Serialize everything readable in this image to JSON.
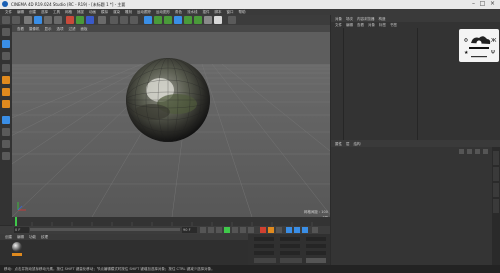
{
  "window": {
    "title": "CINEMA 4D R19.024 Studio (RC - R19) - [未标题 1 *] - 主要"
  },
  "menubar": {
    "items": [
      "文件",
      "编辑",
      "创建",
      "选择",
      "工具",
      "网格",
      "捕捉",
      "动画",
      "模拟",
      "渲染",
      "雕刻",
      "运动跟踪",
      "运动图形",
      "角色",
      "流水线",
      "插件",
      "脚本",
      "窗口",
      "帮助"
    ]
  },
  "viewport": {
    "menu": [
      "查看",
      "摄像机",
      "显示",
      "选项",
      "过滤",
      "面板"
    ],
    "footer": "网格间距 : 100 cm"
  },
  "object_manager": {
    "tabs": [
      "对象",
      "场次",
      "内容浏览器",
      "构造"
    ],
    "menu": [
      "文件",
      "编辑",
      "查看",
      "对象",
      "标签",
      "书签"
    ]
  },
  "attributes": {
    "tabs": [
      "属性",
      "层",
      "结构"
    ]
  },
  "timeline": {
    "frame_field": "0 F",
    "end_field": "90 F"
  },
  "material_manager": {
    "menu": [
      "创建",
      "编辑",
      "功能",
      "纹理"
    ]
  },
  "status": {
    "text": "移动：点击并拖动鼠标移动元素。按住 SHIFT 键量化移动；节点编辑模式时按住 SHIFT 键增加选择对象；按住 CTRL 键减少选择对象。"
  },
  "colors": {
    "accent_orange": "#e08a1e",
    "accent_blue": "#3a8ee6",
    "toolbar_bg": "#3c3c3c",
    "viewport_bg": "#5e5e5e"
  },
  "icons": {
    "app_logo": "cinema4d-logo-icon",
    "window_controls": [
      "minimize-icon",
      "maximize-icon",
      "close-icon"
    ]
  }
}
